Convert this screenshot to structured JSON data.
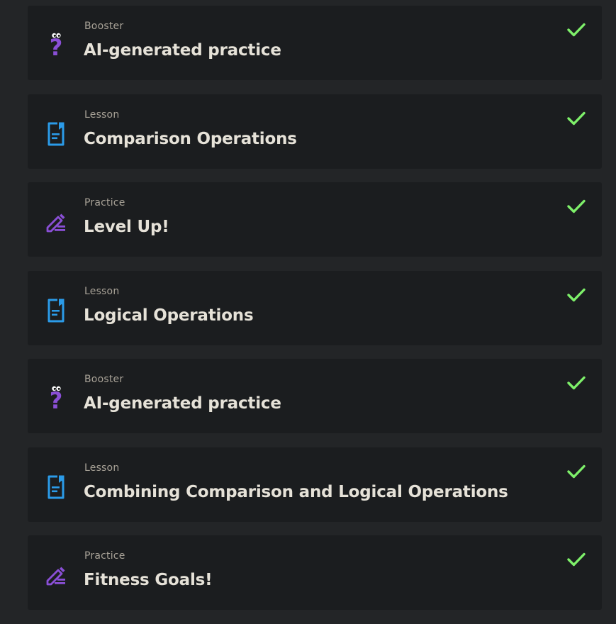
{
  "items": [
    {
      "kind": "Booster",
      "title": "AI-generated practice",
      "icon": "booster-question-icon",
      "completed": true
    },
    {
      "kind": "Lesson",
      "title": "Comparison Operations",
      "icon": "lesson-document-icon",
      "completed": true
    },
    {
      "kind": "Practice",
      "title": "Level Up!",
      "icon": "practice-pencil-icon",
      "completed": true
    },
    {
      "kind": "Lesson",
      "title": "Logical Operations",
      "icon": "lesson-document-icon",
      "completed": true
    },
    {
      "kind": "Booster",
      "title": "AI-generated practice",
      "icon": "booster-question-icon",
      "completed": true
    },
    {
      "kind": "Lesson",
      "title": "Combining Comparison and Logical Operations",
      "icon": "lesson-document-icon",
      "completed": true
    },
    {
      "kind": "Practice",
      "title": "Fitness Goals!",
      "icon": "practice-pencil-icon",
      "completed": true
    }
  ],
  "colors": {
    "background": "#232527",
    "card": "#1b1d1f",
    "title": "#e6e2d8",
    "kind": "#a8a297",
    "check": "#7ef06a",
    "lesson_icon": "#2b9be8",
    "practice_icon": "#8a4fd6",
    "booster_icon": "#8a4fd6"
  }
}
